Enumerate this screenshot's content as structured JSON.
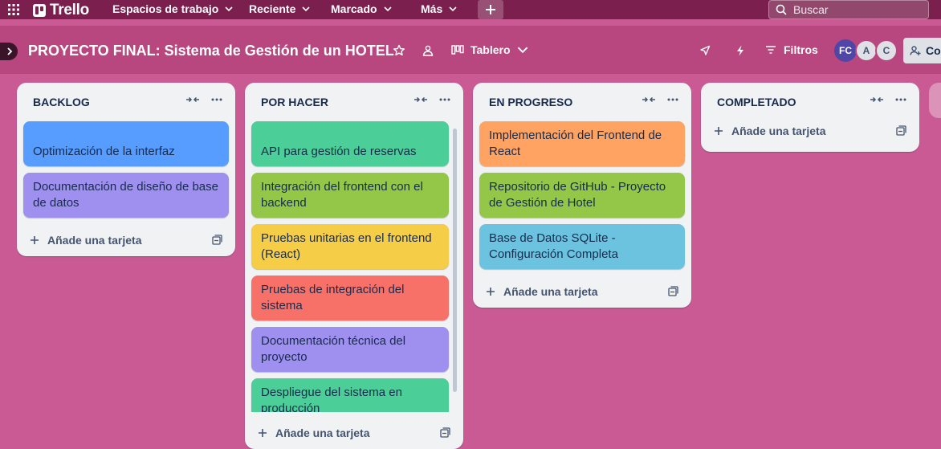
{
  "nav": {
    "logo": "Trello",
    "items": [
      "Espacios de trabajo",
      "Reciente",
      "Marcado",
      "Más"
    ],
    "search_placeholder": "Buscar"
  },
  "board": {
    "title": "PROYECTO FINAL: Sistema de Gestión de un HOTEL",
    "view": "Tablero",
    "filters": "Filtros",
    "members": [
      "FC",
      "A",
      "C"
    ],
    "share_label": "Co"
  },
  "lists": [
    {
      "title": "BACKLOG",
      "add_label": "Añade una tarjeta",
      "cards": [
        {
          "text": "Optimización de la interfaz",
          "color": "#579dff"
        },
        {
          "text": "Documentación de diseño de base de datos",
          "color": "#9f8fef"
        }
      ]
    },
    {
      "title": "POR HACER",
      "add_label": "Añade una tarjeta",
      "cards": [
        {
          "text": "API para gestión de reservas",
          "color": "#4bce97"
        },
        {
          "text": "Integración del frontend con el backend",
          "color": "#94c748"
        },
        {
          "text": "Pruebas unitarias en el frontend (React)",
          "color": "#f5cd47"
        },
        {
          "text": "Pruebas de integración del sistema",
          "color": "#f87168"
        },
        {
          "text": "Documentación técnica del proyecto",
          "color": "#9f8fef"
        },
        {
          "text": "Despliegue del sistema en producción",
          "color": "#4bce97"
        }
      ]
    },
    {
      "title": "EN PROGRESO",
      "add_label": "Añade una tarjeta",
      "cards": [
        {
          "text": "Implementación del Frontend de React",
          "color": "#fea362"
        },
        {
          "text": "Repositorio de GitHub - Proyecto de Gestión de Hotel",
          "color": "#94c748"
        },
        {
          "text": "Base de Datos SQLite - Configuración Completa",
          "color": "#6cc3e0"
        }
      ]
    },
    {
      "title": "COMPLETADO",
      "add_label": "Añade una tarjeta",
      "cards": []
    }
  ]
}
